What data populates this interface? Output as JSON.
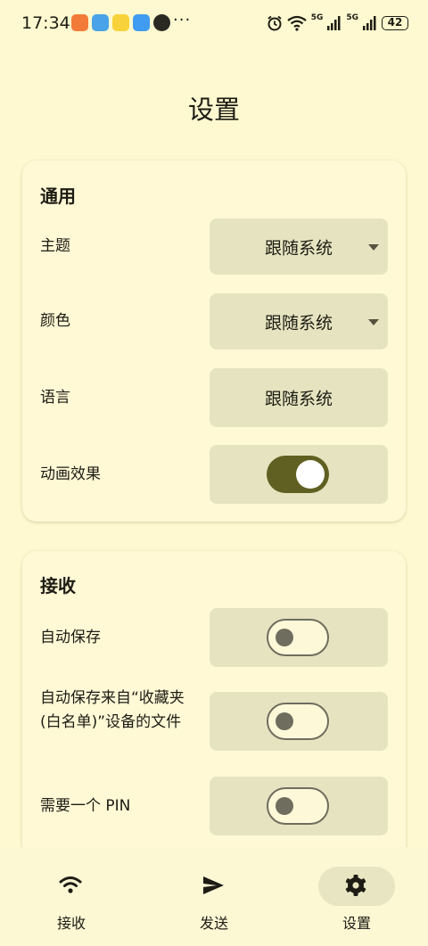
{
  "status_bar": {
    "time": "17:34",
    "dots": "···",
    "net1": "5G",
    "net2": "5G",
    "battery": "42"
  },
  "page": {
    "title": "设置"
  },
  "general": {
    "title": "通用",
    "theme": {
      "label": "主题",
      "value": "跟随系统"
    },
    "color": {
      "label": "颜色",
      "value": "跟随系统"
    },
    "language": {
      "label": "语言",
      "value": "跟随系统"
    },
    "animations": {
      "label": "动画效果",
      "enabled": true
    }
  },
  "receive": {
    "title": "接收",
    "auto_save": {
      "label": "自动保存",
      "enabled": false
    },
    "auto_save_favorites": {
      "label": "自动保存来自“收藏夹(白名单)”设备的文件",
      "enabled": false
    },
    "require_pin": {
      "label": "需要一个 PIN",
      "enabled": false
    }
  },
  "nav": {
    "items": [
      {
        "label": "接收",
        "icon": "wifi-icon",
        "active": false
      },
      {
        "label": "发送",
        "icon": "send-icon",
        "active": false
      },
      {
        "label": "设置",
        "icon": "gear-icon",
        "active": true
      }
    ]
  }
}
